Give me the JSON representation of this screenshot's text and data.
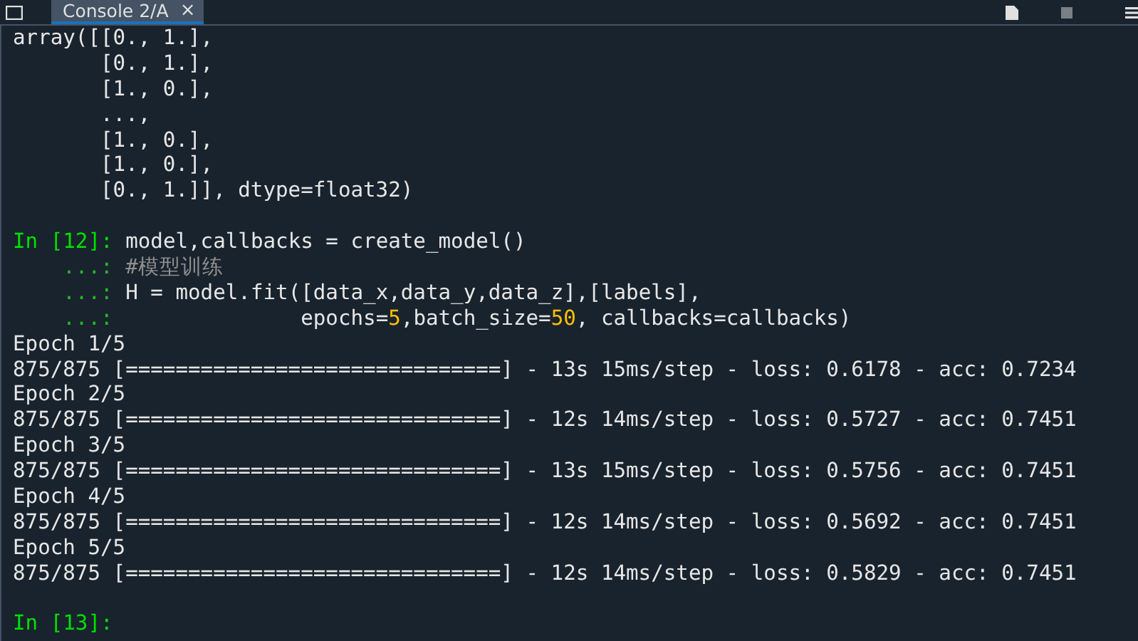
{
  "tab": {
    "label": "Console 2/A",
    "close": "×",
    "selected": true
  },
  "lines": [
    {
      "kind": "output",
      "text": "array([[0., 1.],"
    },
    {
      "kind": "output",
      "text": "       [0., 1.],"
    },
    {
      "kind": "output",
      "text": "       [1., 0.],"
    },
    {
      "kind": "output",
      "text": "       ...,"
    },
    {
      "kind": "output",
      "text": "       [1., 0.],"
    },
    {
      "kind": "output",
      "text": "       [1., 0.],"
    },
    {
      "kind": "output",
      "text": "       [0., 1.]], dtype=float32)"
    },
    {
      "kind": "blank"
    },
    {
      "kind": "input",
      "prompt": "In [12]:",
      "segments": [
        {
          "kind": "code",
          "text": "model,callbacks = create_model()"
        }
      ]
    },
    {
      "kind": "input",
      "prompt": "    ...:",
      "segments": [
        {
          "kind": "comment",
          "text": "#模型训练"
        }
      ]
    },
    {
      "kind": "input",
      "prompt": "    ...:",
      "segments": [
        {
          "kind": "code",
          "text": "H = model.fit([data_x,data_y,data_z],[labels],"
        }
      ]
    },
    {
      "kind": "input",
      "prompt": "    ...:",
      "segments": [
        {
          "kind": "code",
          "text": "              epochs="
        },
        {
          "kind": "number",
          "text": "5"
        },
        {
          "kind": "code",
          "text": ",batch_size="
        },
        {
          "kind": "number",
          "text": "50"
        },
        {
          "kind": "code",
          "text": ", callbacks=callbacks)"
        }
      ]
    },
    {
      "kind": "output",
      "text": "Epoch 1/5"
    },
    {
      "kind": "output",
      "text": "875/875 [==============================] - 13s 15ms/step - loss: 0.6178 - acc: 0.7234"
    },
    {
      "kind": "output",
      "text": "Epoch 2/5"
    },
    {
      "kind": "output",
      "text": "875/875 [==============================] - 12s 14ms/step - loss: 0.5727 - acc: 0.7451"
    },
    {
      "kind": "output",
      "text": "Epoch 3/5"
    },
    {
      "kind": "output",
      "text": "875/875 [==============================] - 13s 15ms/step - loss: 0.5756 - acc: 0.7451"
    },
    {
      "kind": "output",
      "text": "Epoch 4/5"
    },
    {
      "kind": "output",
      "text": "875/875 [==============================] - 12s 14ms/step - loss: 0.5692 - acc: 0.7451"
    },
    {
      "kind": "output",
      "text": "Epoch 5/5"
    },
    {
      "kind": "output",
      "text": "875/875 [==============================] - 12s 14ms/step - loss: 0.5829 - acc: 0.7451"
    },
    {
      "kind": "blank"
    },
    {
      "kind": "input",
      "prompt": "In [13]:"
    }
  ]
}
